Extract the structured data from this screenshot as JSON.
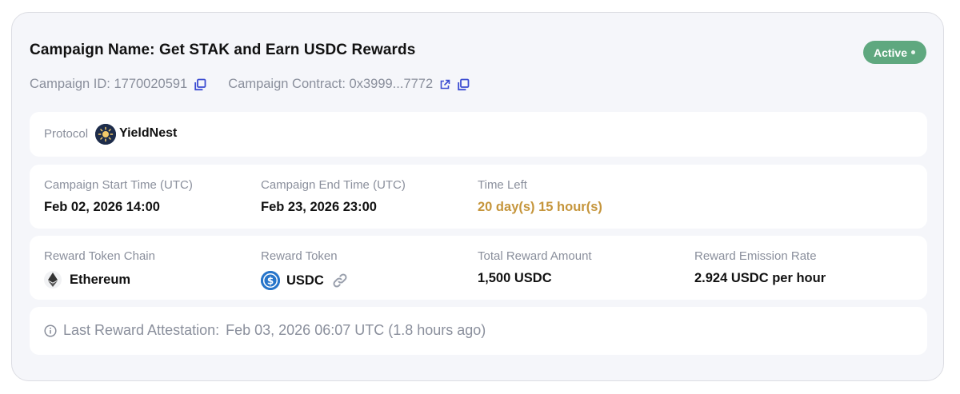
{
  "campaign": {
    "title": "Campaign Name: Get STAK and Earn USDC Rewards",
    "status": "Active",
    "id_text": "Campaign ID: 1770020591",
    "contract_text": "Campaign Contract: 0x3999...7772"
  },
  "protocol": {
    "label": "Protocol",
    "name": "YieldNest",
    "logo_icon": "sun-icon"
  },
  "timing": {
    "start_label": "Campaign Start Time (UTC)",
    "start_value": "Feb 02, 2026 14:00",
    "end_label": "Campaign End Time (UTC)",
    "end_value": "Feb 23, 2026 23:00",
    "left_label": "Time Left",
    "left_value": "20 day(s) 15 hour(s)"
  },
  "reward": {
    "chain_label": "Reward Token Chain",
    "chain_value": "Ethereum",
    "token_label": "Reward Token",
    "token_value": "USDC",
    "total_label": "Total Reward Amount",
    "total_value": "1,500 USDC",
    "rate_label": "Reward Emission Rate",
    "rate_value": "2.924 USDC per hour"
  },
  "attestation": {
    "label": "Last Reward Attestation:",
    "value": "Feb 03, 2026 06:07 UTC (1.8 hours ago)"
  },
  "colors": {
    "active_badge": "#5fa87f",
    "time_left": "#c5953b",
    "icon_accent": "#3b4bd1",
    "usdc_blue": "#2775ca"
  }
}
